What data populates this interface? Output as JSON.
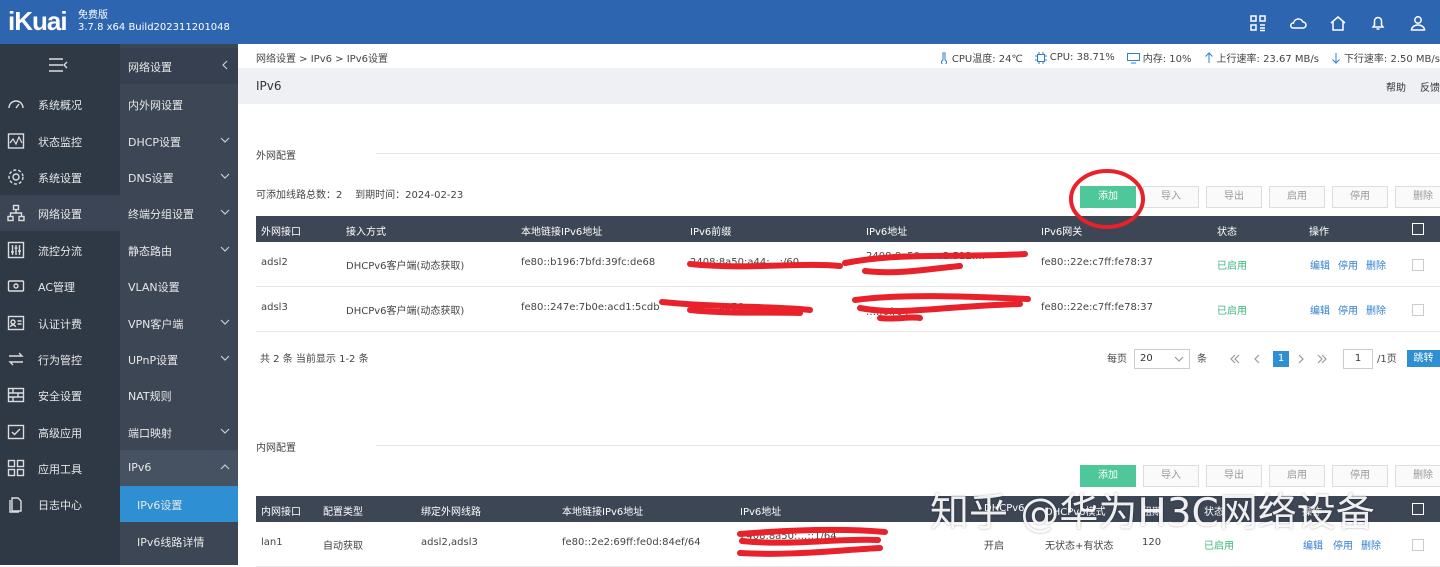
{
  "app": {
    "logo": "iKuai",
    "edition": "免费版",
    "version": "3.7.8 x64 Build202311201048"
  },
  "top_icons": [
    "apps-icon",
    "cloud-icon",
    "home-icon",
    "bell-icon",
    "user-icon"
  ],
  "nav_primary": [
    {
      "label": "系统概况",
      "icon": "dashboard-icon"
    },
    {
      "label": "状态监控",
      "icon": "monitor-icon"
    },
    {
      "label": "系统设置",
      "icon": "gear-icon"
    },
    {
      "label": "网络设置",
      "icon": "network-icon"
    },
    {
      "label": "流控分流",
      "icon": "sliders-icon"
    },
    {
      "label": "AC管理",
      "icon": "router-icon"
    },
    {
      "label": "认证计费",
      "icon": "id-card-icon"
    },
    {
      "label": "行为管控",
      "icon": "swap-icon"
    },
    {
      "label": "安全设置",
      "icon": "firewall-icon"
    },
    {
      "label": "高级应用",
      "icon": "checklist-icon"
    },
    {
      "label": "应用工具",
      "icon": "tools-icon"
    },
    {
      "label": "日志中心",
      "icon": "document-icon"
    }
  ],
  "nav_secondary": {
    "header": "网络设置",
    "items": [
      {
        "label": "内外网设置"
      },
      {
        "label": "DHCP设置"
      },
      {
        "label": "DNS设置"
      },
      {
        "label": "终端分组设置"
      },
      {
        "label": "静态路由"
      },
      {
        "label": "VLAN设置"
      },
      {
        "label": "VPN客户端"
      },
      {
        "label": "UPnP设置"
      },
      {
        "label": "NAT规则"
      },
      {
        "label": "端口映射"
      },
      {
        "label": "IPv6"
      },
      {
        "label": "IPv6设置"
      },
      {
        "label": "IPv6线路详情"
      }
    ]
  },
  "breadcrumb": "网络设置 > IPv6 > IPv6设置",
  "stats": {
    "cpu_temp": "CPU温度: 24℃",
    "cpu": "CPU: 38.71%",
    "mem": "内存: 10%",
    "up": "上行速率: 23.67 MB/s",
    "down": "下行速率: 2.50 MB/s"
  },
  "page": {
    "title": "IPv6",
    "help": "帮助",
    "feedback": "反馈"
  },
  "buttons": {
    "add": "添加",
    "import": "导入",
    "export": "导出",
    "enable": "启用",
    "disable": "停用",
    "delete": "删除"
  },
  "wan": {
    "title": "外网配置",
    "info_count": "可添加线路总数：2",
    "info_expire": "到期时间：2024-02-23",
    "columns": [
      "外网接口",
      "接入方式",
      "本地链接IPv6地址",
      "IPv6前缀",
      "IPv6地址",
      "IPv6网关",
      "状态",
      "操作"
    ],
    "rows": [
      {
        "iface": "adsl2",
        "mode": "DHCPv6客户端(动态获取)",
        "local": "fe80::b196:7bfd:39fc:de68",
        "prefix": "2408:8a50:a44:…:/60",
        "addr": "2408:8a50:…:a2:512:…",
        "gateway": "fe80::22e:c7ff:fe78:37",
        "status": "已启用",
        "edit": "编辑",
        "disable": "停用",
        "delete": "删除"
      },
      {
        "iface": "adsl3",
        "mode": "DHCPv6客户端(动态获取)",
        "local": "fe80::247e:7b0e:acd1:5cdb",
        "prefix": "2408:8a50:…",
        "addr": "…:f0f/64",
        "gateway": "fe80::22e:c7ff:fe78:37",
        "status": "已启用",
        "edit": "编辑",
        "disable": "停用",
        "delete": "删除"
      }
    ],
    "pager": {
      "summary": "共 2 条 当前显示 1-2 条",
      "per_page_label": "每页",
      "per_page": "20",
      "unit": "条",
      "current": "1",
      "page_input": "1",
      "total_pages": "/1页",
      "go": "跳转"
    }
  },
  "lan": {
    "title": "内网配置",
    "columns": [
      "内网接口",
      "配置类型",
      "绑定外网线路",
      "本地链接IPv6地址",
      "IPv6地址",
      "DHCPv6",
      "DHCPv6模式",
      "租期",
      "状态",
      "操作"
    ],
    "rows": [
      {
        "iface": "lan1",
        "type": "自动获取",
        "bind": "adsl2,adsl3",
        "local": "fe80::2e2:69ff:fe0d:84ef/64",
        "addr": "2408:8a50:…::1/64",
        "dhcpv6": "开启",
        "mode": "无状态+有状态",
        "lease": "120",
        "status": "已启用",
        "edit": "编辑",
        "disable": "停用",
        "delete": "删除"
      }
    ]
  },
  "watermark": "知乎 @华为H3C网络设备",
  "colors": {
    "topbar": "#2e65b0",
    "sidebar": "#2f3845",
    "subnav": "#3d4654",
    "active": "#2f8fd3",
    "primary_button": "#4ec79a",
    "status_green": "#39b87d",
    "annotation_red": "#e8212a"
  }
}
